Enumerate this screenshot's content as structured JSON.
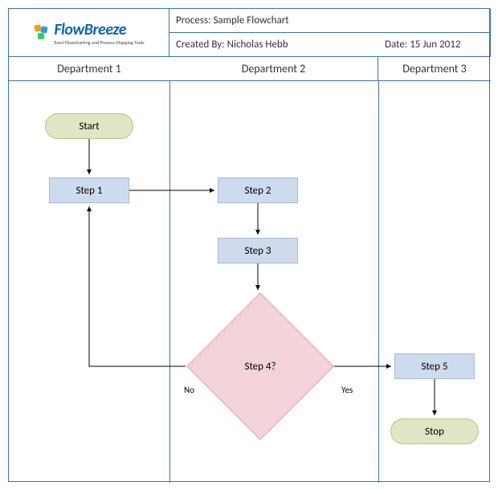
{
  "header": {
    "process_label": "Process: Sample Flowchart",
    "created_by_label": "Created By: Nicholas Hebb",
    "date_label": "Date: 15 Jun 2012"
  },
  "lanes": {
    "lane1": "Department 1",
    "lane2": "Department 2",
    "lane3": "Department 3"
  },
  "logo": {
    "name": "FlowBreeze",
    "tagline": "Excel Flowcharting and Process Mapping Tools"
  },
  "nodes": {
    "start": "Start",
    "step1": "Step 1",
    "step2": "Step 2",
    "step3": "Step 3",
    "step4": "Step 4?",
    "step5": "Step 5",
    "stop": "Stop"
  },
  "edges": {
    "no": "No",
    "yes": "Yes"
  }
}
